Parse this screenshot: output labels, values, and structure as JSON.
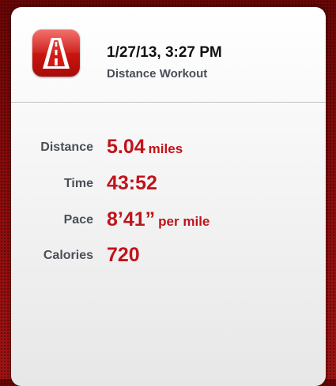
{
  "workout": {
    "date_time": "1/27/13, 3:27 PM",
    "type": "Distance Workout"
  },
  "app_icon": {
    "name": "road-icon"
  },
  "stats": {
    "distance": {
      "label": "Distance",
      "value": "5.04",
      "unit": "miles"
    },
    "time": {
      "label": "Time",
      "value": "43:52"
    },
    "pace": {
      "label": "Pace",
      "value": "8’41”",
      "unit": "per mile"
    },
    "calories": {
      "label": "Calories",
      "value": "720"
    }
  },
  "colors": {
    "accent": "#c0141b",
    "background": "#8e0d0d",
    "label": "#4a4f57"
  }
}
